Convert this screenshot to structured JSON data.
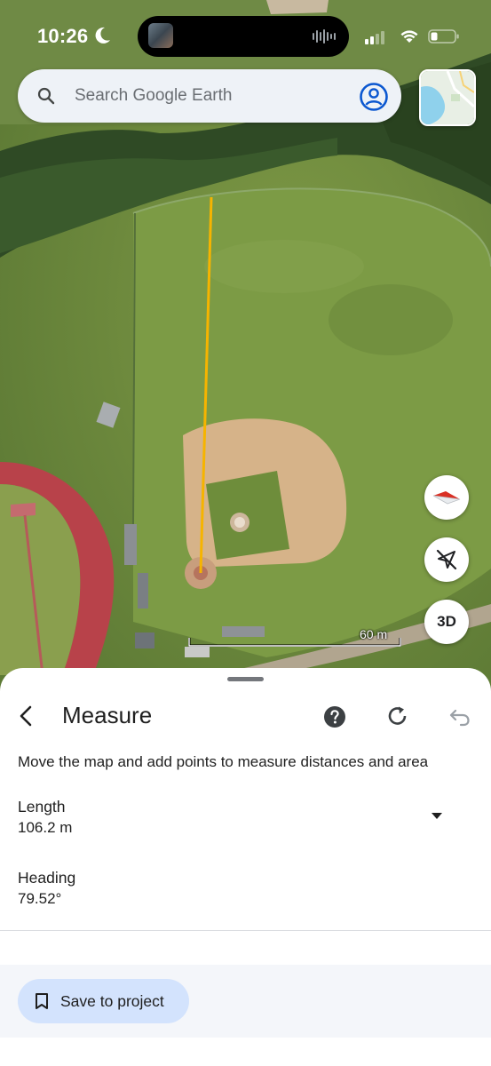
{
  "status_bar": {
    "time": "10:26"
  },
  "search": {
    "placeholder": "Search Google Earth"
  },
  "map": {
    "scale_label": "60 m",
    "view_mode_label": "3D"
  },
  "measure": {
    "title": "Measure",
    "instructions": "Move the map and add points to measure distances and area",
    "length_label": "Length",
    "length_value": "106.2 m",
    "heading_label": "Heading",
    "heading_value": "79.52°",
    "save_label": "Save to project"
  },
  "colors": {
    "measure_line": "#f6b400",
    "accent": "#0b57d0",
    "save_button_bg": "#d3e3fd"
  },
  "icons": [
    "search-icon",
    "account-icon",
    "compass-icon",
    "my-location-off-icon",
    "back-icon",
    "help-icon",
    "redo-icon",
    "undo-icon",
    "dropdown-icon",
    "bookmark-icon"
  ]
}
